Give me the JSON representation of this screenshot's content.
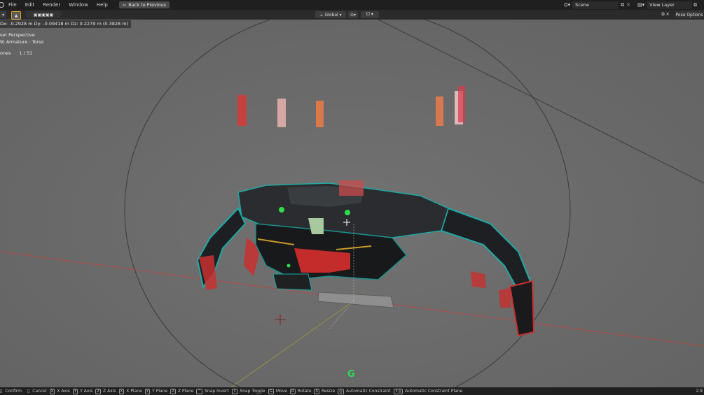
{
  "menu": [
    "File",
    "Edit",
    "Render",
    "Window",
    "Help"
  ],
  "back_button": "Back to Previous",
  "scene_field": "Scene",
  "view_layer_field": "View Layer",
  "transform_orientation": "Global",
  "pose_options": "Pose Options",
  "operator_info": "Dx: -0.2928 m   Dy: -0.09418 m   Dz: 0.2279 m (0.3828 m)",
  "overlay": {
    "view_name": "ser Perspective",
    "object_name": "9) Armature : Torso",
    "bones_label": "ones",
    "bones_count": "1 / 51"
  },
  "grab_letter": "G",
  "status": [
    {
      "label": "Confirm"
    },
    {
      "label": "Cancel"
    },
    {
      "key": "X",
      "label": "X Axis"
    },
    {
      "key": "Y",
      "label": "Y Axis"
    },
    {
      "key": "Z",
      "label": "Z Axis"
    },
    {
      "key": "X",
      "label": "X Plane"
    },
    {
      "key": "Y",
      "label": "Y Plane"
    },
    {
      "key": "Z",
      "label": "Z Plane"
    },
    {
      "label": "Snap Invert"
    },
    {
      "label": "Snap Toggle"
    },
    {
      "key": "G",
      "label": "Move"
    },
    {
      "key": "R",
      "label": "Rotate"
    },
    {
      "key": "S",
      "label": "Resize"
    },
    {
      "label": "Automatic Constraint"
    },
    {
      "label": "Automatic Constraint Plane"
    }
  ],
  "version_fragment": "2.9",
  "colors": {
    "robot_teal": "#1fa9a4",
    "robot_dark": "#1d1f22",
    "bone_red": "#d63a3a",
    "grid_red": "#b24a4a"
  }
}
